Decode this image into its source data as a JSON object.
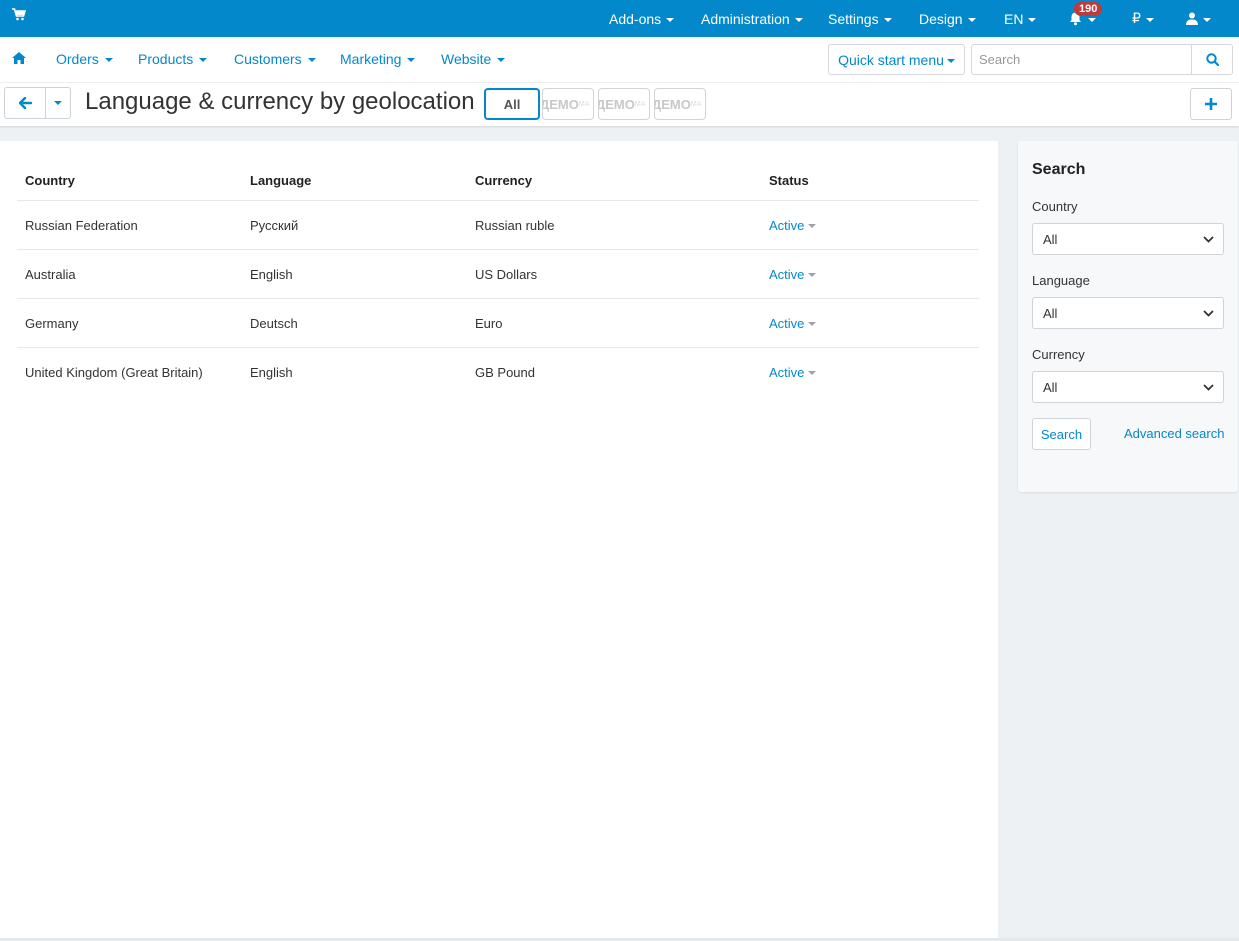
{
  "topbar": {
    "menu": [
      "Add-ons",
      "Administration",
      "Settings",
      "Design",
      "EN"
    ],
    "notifications_count": "190",
    "currency_symbol": "₽"
  },
  "nav": {
    "items": [
      "Orders",
      "Products",
      "Customers",
      "Marketing",
      "Website"
    ],
    "quick_start": "Quick start menu",
    "search_placeholder": "Search"
  },
  "page": {
    "title": "Language & currency by geolocation",
    "store_filter_all": "All",
    "store_demo_label": "ДЕМО",
    "store_demo_suffix": "МА"
  },
  "table": {
    "headers": [
      "Country",
      "Language",
      "Currency",
      "Status"
    ],
    "rows": [
      {
        "country": "Russian Federation",
        "language": "Русский",
        "currency": "Russian ruble",
        "status": "Active"
      },
      {
        "country": "Australia",
        "language": "English",
        "currency": "US Dollars",
        "status": "Active"
      },
      {
        "country": "Germany",
        "language": "Deutsch",
        "currency": "Euro",
        "status": "Active"
      },
      {
        "country": "United Kingdom (Great Britain)",
        "language": "English",
        "currency": "GB Pound",
        "status": "Active"
      }
    ]
  },
  "sidebar": {
    "title": "Search",
    "country_label": "Country",
    "country_value": "All",
    "language_label": "Language",
    "language_value": "All",
    "currency_label": "Currency",
    "currency_value": "All",
    "search_button": "Search",
    "advanced_search": "Advanced search"
  },
  "colors": {
    "accent": "#0388cc",
    "badge": "#c03a3a"
  }
}
